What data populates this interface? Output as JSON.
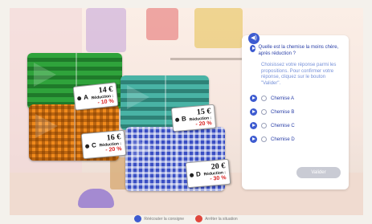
{
  "shirts": [
    {
      "letter": "A",
      "price": "14 €",
      "reduction_label": "Réduction :",
      "reduction": "- 10 %"
    },
    {
      "letter": "B",
      "price": "15 €",
      "reduction_label": "Réduction :",
      "reduction": "- 20 %"
    },
    {
      "letter": "C",
      "price": "16 €",
      "reduction_label": "Réduction :",
      "reduction": "- 20 %"
    },
    {
      "letter": "D",
      "price": "20 €",
      "reduction_label": "Réduction :",
      "reduction": "- 30 %"
    }
  ],
  "panel": {
    "question": "Quelle est la chemise la moins chère, après réduction ?",
    "instructions": "Choisissez votre réponse parmi les propositions. Pour confirmer votre réponse, cliquez sur le bouton \"Valider\".",
    "options": [
      {
        "label": "Chemise A"
      },
      {
        "label": "Chemise B"
      },
      {
        "label": "Chemise C"
      },
      {
        "label": "Chemise D"
      }
    ],
    "validate_label": "Valider"
  },
  "footer": {
    "replay_label": "Réécouter la consigne",
    "situation_label": "Arrêter la situation"
  },
  "colors": {
    "accent": "#3d5bd0",
    "reduction_red": "#d91e1e",
    "shirt_a": "#2fa33b",
    "shirt_b": "#49b3a5",
    "shirt_c": "#f08a1c",
    "shirt_d": "#3a4fc4"
  }
}
